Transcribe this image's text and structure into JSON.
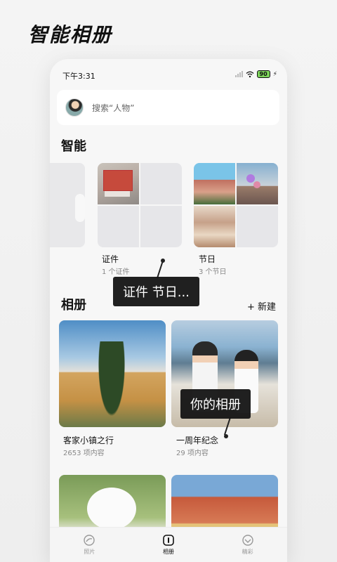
{
  "promo": {
    "title": "智能相册"
  },
  "status": {
    "time": "下午3:31",
    "battery": "90"
  },
  "search": {
    "placeholder": "搜索“人物”"
  },
  "smart": {
    "title": "智能",
    "cards": [
      {
        "name": "证件",
        "count": "1 个证件"
      },
      {
        "name": "节日",
        "count": "3 个节日"
      }
    ]
  },
  "albums": {
    "title": "相册",
    "add_label": "+ 新建",
    "items": [
      {
        "name": "客家小镇之行",
        "count": "2653 项内容"
      },
      {
        "name": "一周年纪念",
        "count": "29 项内容"
      }
    ]
  },
  "tooltips": {
    "smart": "证件  节日...",
    "albums": "你的相册"
  },
  "tabs": [
    {
      "label": "照片",
      "icon": "photos-icon"
    },
    {
      "label": "相册",
      "icon": "albums-icon"
    },
    {
      "label": "精彩",
      "icon": "highlights-icon"
    }
  ]
}
